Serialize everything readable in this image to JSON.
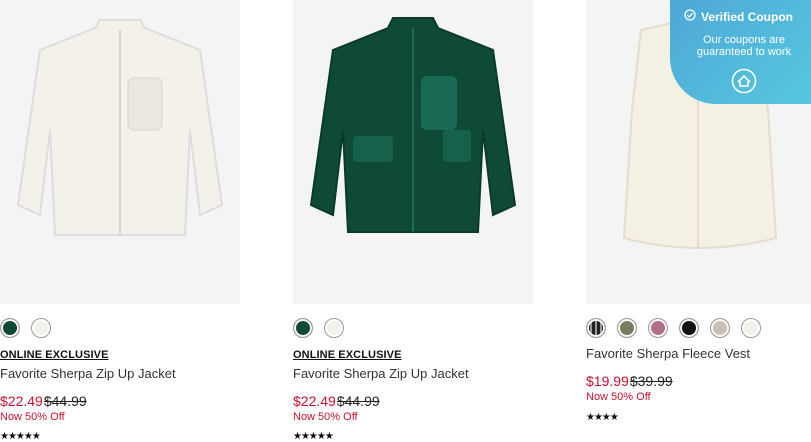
{
  "products": [
    {
      "exclusive": "ONLINE EXCLUSIVE",
      "name": "Favorite Sherpa Zip Up Jacket",
      "sale_price": "$22.49",
      "original_price": "$44.99",
      "promo": "Now 50% Off",
      "swatches": [
        "#0f4a37",
        "#f3f1ea"
      ],
      "rating_display": "★★★★★",
      "jacket_color": "#f3f1ea"
    },
    {
      "exclusive": "ONLINE EXCLUSIVE",
      "name": "Favorite Sherpa Zip Up Jacket",
      "sale_price": "$22.49",
      "original_price": "$44.99",
      "promo": "Now 50% Off",
      "swatches": [
        "#0f4a37",
        "#f3f1ea"
      ],
      "rating_display": "★★★★★",
      "jacket_color": "#0f4a37"
    },
    {
      "name": "Favorite Sherpa Fleece Vest",
      "sale_price": "$19.99",
      "original_price": "$39.99",
      "promo": "Now 50% Off",
      "swatches": [
        "#2a2a2a",
        "#7c7a5f",
        "#b26f8a",
        "#111111",
        "#c9bfb2",
        "#f3f1ea"
      ],
      "rating_display": "★★★★",
      "vest_color": "#f5f0e4"
    }
  ],
  "coupon": {
    "title": "Verified Coupon",
    "subtitle": "Our coupons are guaranteed to work",
    "icon": "check-circle-icon",
    "bg_color": "#4fa7d8"
  }
}
